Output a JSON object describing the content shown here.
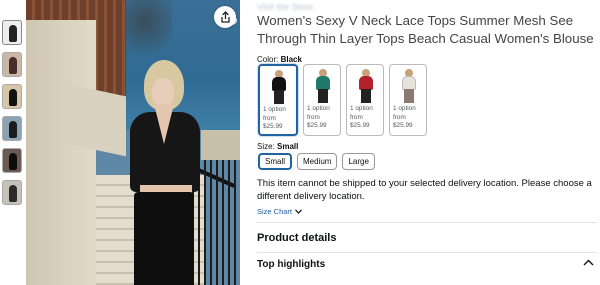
{
  "gallery": {
    "thumbnail_count": 6
  },
  "product": {
    "store_link": "Visit the Store",
    "title": "Women's Sexy V Neck Lace Tops Summer Mesh See Through Thin Layer Tops Beach Casual Women's Blouse"
  },
  "color": {
    "label": "Color:",
    "selected": "Black",
    "options": [
      {
        "line1": "1 option",
        "line2": "from",
        "price": "$25.99",
        "swatch": "#111111"
      },
      {
        "line1": "1 option",
        "line2": "from",
        "price": "$25.99",
        "swatch": "#1f7a6a"
      },
      {
        "line1": "1 option",
        "line2": "from",
        "price": "$25.99",
        "swatch": "#b3212b"
      },
      {
        "line1": "1 option",
        "line2": "from",
        "price": "$25.99",
        "swatch": "#e7e2dc"
      }
    ]
  },
  "size": {
    "label": "Size:",
    "selected": "Small",
    "options": [
      "Small",
      "Medium",
      "Large"
    ]
  },
  "shipping": {
    "message": "This item cannot be shipped to your selected delivery location. Please choose a different delivery location."
  },
  "size_chart": {
    "label": "Size Chart"
  },
  "sections": {
    "product_details": "Product details",
    "top_highlights": "Top highlights"
  },
  "colors": {
    "link": "#2162a1",
    "selected_border": "#2162a1"
  }
}
